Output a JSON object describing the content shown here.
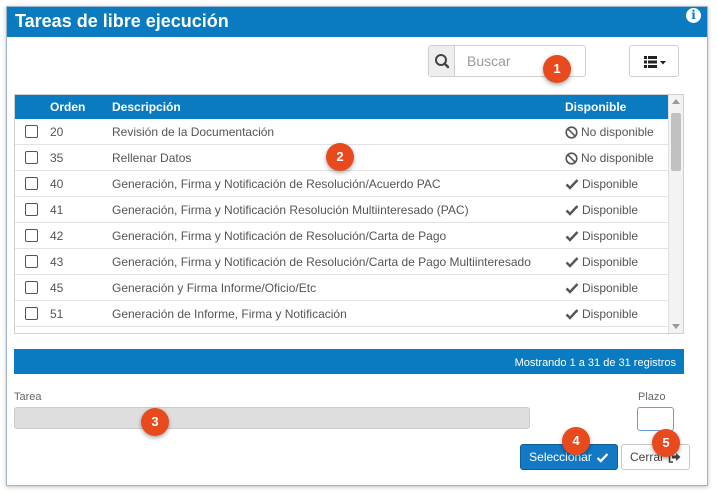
{
  "dialog": {
    "title": "Tareas de libre ejecución"
  },
  "search": {
    "placeholder": "Buscar",
    "value": ""
  },
  "table": {
    "headers": {
      "orden": "Orden",
      "descripcion": "Descripción",
      "disponible": "Disponible"
    },
    "rows": [
      {
        "orden": "20",
        "descripcion": "Revisión de la Documentación",
        "disponible": "No disponible",
        "status": "unavailable"
      },
      {
        "orden": "35",
        "descripcion": "Rellenar Datos",
        "disponible": "No disponible",
        "status": "unavailable"
      },
      {
        "orden": "40",
        "descripcion": "Generación, Firma y Notificación de Resolución/Acuerdo PAC",
        "disponible": "Disponible",
        "status": "available"
      },
      {
        "orden": "41",
        "descripcion": "Generación, Firma y Notificación Resolución Multiinteresado (PAC)",
        "disponible": "Disponible",
        "status": "available"
      },
      {
        "orden": "42",
        "descripcion": "Generación, Firma y Notificación de Resolución/Carta de Pago",
        "disponible": "Disponible",
        "status": "available"
      },
      {
        "orden": "43",
        "descripcion": "Generación, Firma y Notificación de Resolución/Carta de Pago Multiinteresado",
        "disponible": "Disponible",
        "status": "available"
      },
      {
        "orden": "45",
        "descripcion": "Generación y Firma Informe/Oficio/Etc",
        "disponible": "Disponible",
        "status": "available"
      },
      {
        "orden": "51",
        "descripcion": "Generación de Informe, Firma y Notificación",
        "disponible": "Disponible",
        "status": "available"
      }
    ]
  },
  "footer": {
    "records": "Mostrando 1 a 31 de 31 registros"
  },
  "form": {
    "tarea_label": "Tarea",
    "plazo_label": "Plazo",
    "plazo_value": ""
  },
  "buttons": {
    "seleccionar": "Seleccionar",
    "cerrar": "Cerrar"
  },
  "markers": [
    "1",
    "2",
    "3",
    "4",
    "5"
  ],
  "colors": {
    "primary": "#0a7bc1",
    "marker": "#e8491d"
  },
  "icons": {
    "info": "info-icon",
    "search": "search-icon",
    "columns": "list-columns-icon",
    "check": "check-icon",
    "ban": "ban-icon",
    "logout": "sign-out-icon"
  }
}
